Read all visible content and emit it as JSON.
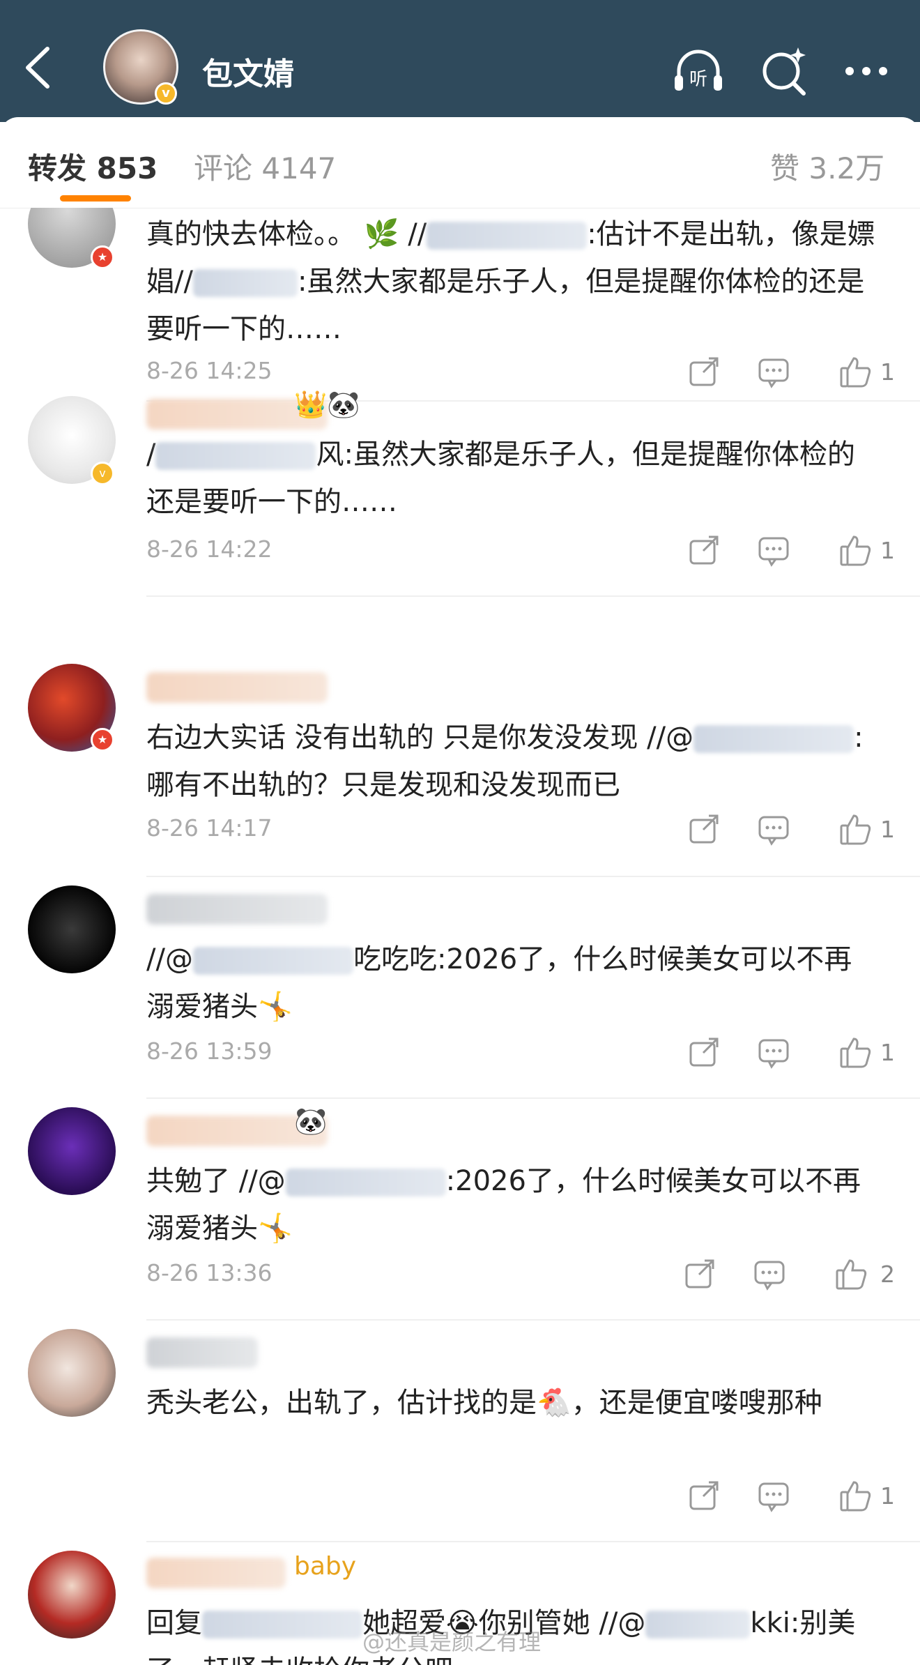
{
  "header": {
    "user_name": "包文婧",
    "bg_color": "#2f4a5c"
  },
  "icons": {
    "back": "chevron-left-icon",
    "listen": "headphones-listen-icon",
    "listen_label": "听",
    "search": "search-sparkle-icon",
    "more": "more-dots-icon"
  },
  "tabs": {
    "repost_label": "转发",
    "repost_count": "853",
    "comment_label": "评论",
    "comment_count": "4147",
    "like_label": "赞",
    "like_count": "3.2万",
    "accent": "#ff8200"
  },
  "comments": [
    {
      "text_a": "真的快去体检。。 🌿 //",
      "text_b": ":估计不是出轨，像是嫖娼//",
      "text_c": ":虽然大家都是乐子人，但是提醒你体检的还是要听一下的……",
      "time": "8-26 14:25",
      "likes": "1"
    },
    {
      "name_emoji": "👑🐼",
      "text_a": "/",
      "text_b": "风:虽然大家都是乐子人，但是提醒你体检的还是要听一下的……",
      "time": "8-26 14:22",
      "likes": "1"
    },
    {
      "text_a": "右边大实话 没有出轨的 只是你发没发现 //@",
      "text_b": ":哪有不出轨的？只是发现和没发现而已",
      "time": "8-26 14:17",
      "likes": "1"
    },
    {
      "text_a": "//@",
      "text_b": "吃吃吃:2026了，什么时候美女可以不再溺爱猪头🤸",
      "time": "8-26 13:59",
      "likes": "1"
    },
    {
      "name_emoji": "🐼",
      "text_a": "共勉了 //@",
      "text_b": ":2026了，什么时候美女可以不再溺爱猪头🤸",
      "time": "8-26 13:36",
      "likes": "2"
    },
    {
      "text_a": "秃头老公，出轨了，估计找的是🐔，还是便宜喽嗖那种",
      "likes": "1"
    },
    {
      "name_text": "baby",
      "text_a": "回复",
      "text_b": "她超爱😭你别管她 //@",
      "text_c": "kki:别美了，赶紧去收拾你老公吧"
    }
  ],
  "watermark": "@还真是颜之有理"
}
